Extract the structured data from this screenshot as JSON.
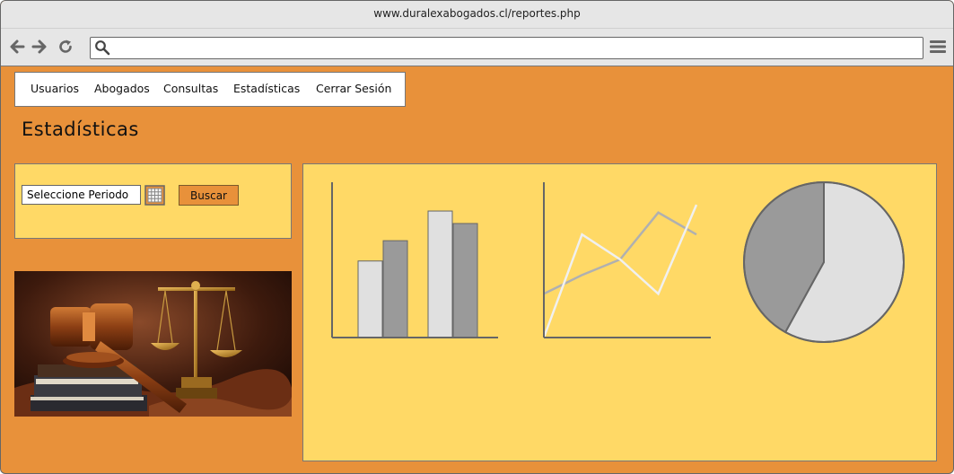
{
  "browser": {
    "title": "www.duralexabogados.cl/reportes.php",
    "url_value": "",
    "icons": [
      "back-arrow-icon",
      "forward-arrow-icon",
      "reload-icon",
      "search-icon",
      "hamburger-menu-icon"
    ]
  },
  "nav": {
    "items": [
      "Usuarios",
      "Abogados",
      "Consultas",
      "Estadísticas",
      "Cerrar Sesión"
    ]
  },
  "page": {
    "title": "Estadísticas"
  },
  "filter": {
    "period_value": "Seleccione Periodo",
    "search_label": "Buscar",
    "calendar_icon": "calendar-icon"
  },
  "image": {
    "subject": "gavel-scales-books"
  },
  "colors": {
    "page_bg": "#e8913a",
    "panel_bg": "#ffd966",
    "button_bg": "#e8913a",
    "light_gray": "#e0e0e0",
    "dark_gray": "#9a9a9a",
    "line_light": "#f0f0f0",
    "line_gray": "#b0b0b0"
  },
  "chart_data": [
    {
      "type": "bar",
      "categories": [
        "",
        ""
      ],
      "series": [
        {
          "values": [
            49,
            81
          ]
        },
        {
          "values": [
            62,
            73
          ]
        }
      ],
      "ylim": [
        0,
        100
      ],
      "grid": false
    },
    {
      "type": "line",
      "x": [
        0,
        1,
        2,
        3,
        4
      ],
      "series": [
        {
          "values": [
            28,
            40,
            50,
            80,
            66
          ]
        },
        {
          "values": [
            0,
            66,
            50,
            28,
            85
          ]
        }
      ],
      "ylim": [
        0,
        100
      ],
      "grid": false
    },
    {
      "type": "pie",
      "values": [
        58,
        42
      ]
    }
  ]
}
